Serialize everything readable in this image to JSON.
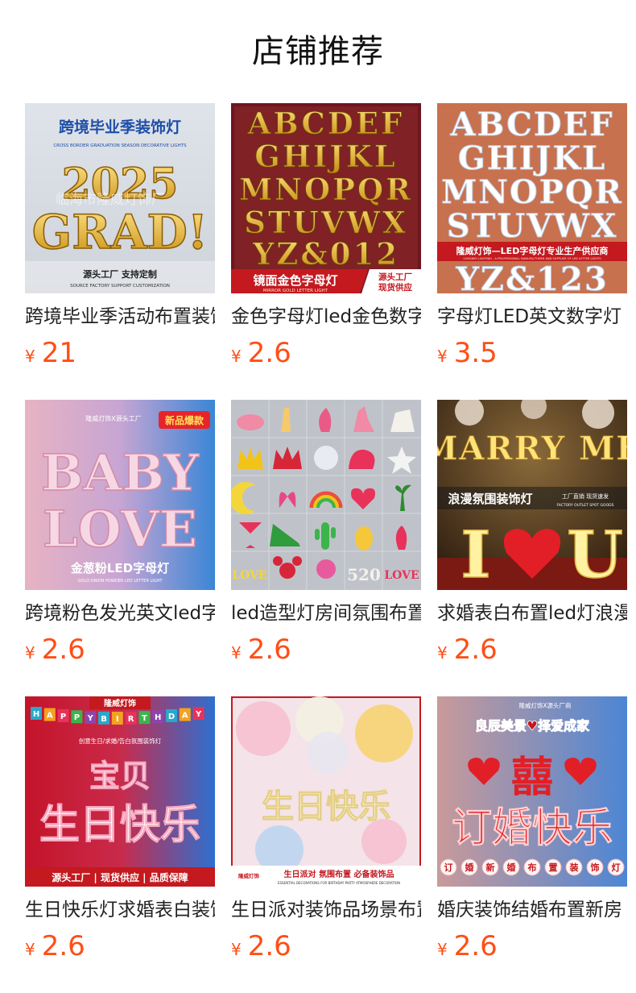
{
  "header": {
    "title": "店铺推荐"
  },
  "products": [
    {
      "title": "跨境毕业季活动布置装饰灯",
      "currency": "¥",
      "price": "21",
      "image": {
        "headline": "跨境毕业季装饰灯",
        "subline": "CROSS BORDER GRADUATION SEASON DECORATIVE LIGHTS",
        "big_top": "2025",
        "big_bottom": "GRAD!",
        "watermark": "临海市隆威灯饰厂",
        "footer": "源头工厂  支持定制",
        "footer_sub": "SOURCE FACTORY   SUPPORT CUSTOMIZATION"
      }
    },
    {
      "title": "金色字母灯led金色数字灯",
      "currency": "¥",
      "price": "2.6",
      "image": {
        "rows": [
          "ABCDEF",
          "GHIJKL",
          "MNOPQR",
          "STUVWX",
          "YZ&012"
        ],
        "banner": "镜面金色字母灯",
        "banner_sub": "MIRROR GOLD LETTER LIGHT",
        "tag_1": "源头工厂",
        "tag_2": "现货供应"
      }
    },
    {
      "title": "字母灯LED英文数字灯",
      "currency": "¥",
      "price": "3.5",
      "image": {
        "rows": [
          "ABCDEF",
          "GHIJKL",
          "MNOPQR",
          "STUVWX",
          "YZ&123"
        ],
        "banner": "隆威灯饰—LED字母灯专业生产供应商",
        "banner_sub": "LONGWEI LIGHTING - A PROFESSIONAL MANUFACTURER AND SUPPLIER OF LED LETTER LIGHTS"
      }
    },
    {
      "title": "跨境粉色发光英文led字母灯",
      "currency": "¥",
      "price": "2.6",
      "image": {
        "brand": "隆威灯饰X源头工厂",
        "badge": "新品爆款",
        "word_1": "BABY",
        "word_2": "LOVE",
        "footer": "金葱粉LED字母灯",
        "footer_sub": "GOLD ONION POWDER LED LETTER LIGHT"
      }
    },
    {
      "title": "led造型灯房间氛围布置",
      "currency": "¥",
      "price": "2.6",
      "image": {
        "tile_1": "LOVE",
        "tile_2": "520",
        "tile_3": "LOVE"
      }
    },
    {
      "title": "求婚表白布置led灯浪漫",
      "currency": "¥",
      "price": "2.6",
      "image": {
        "word_top": "MARRY ME",
        "banner": "浪漫氛围装饰灯",
        "tag_1": "工厂直销  现货速发",
        "tag_2": "FACTORY OUTLET   SPOT GOODS",
        "letter_1": "I",
        "letter_2": "U"
      }
    },
    {
      "title": "生日快乐灯求婚表白装饰",
      "currency": "¥",
      "price": "2.6",
      "image": {
        "brand": "隆威灯饰",
        "bunting": [
          "H",
          "A",
          "P",
          "P",
          "Y",
          "B",
          "I",
          "R",
          "T",
          "H",
          "D",
          "A",
          "Y"
        ],
        "subline": "创意生日/求婚/告白氛围装饰灯",
        "word_1": "宝贝",
        "word_2": "生日快乐",
        "footer": "源头工厂 | 现货供应 | 品质保障"
      }
    },
    {
      "title": "生日派对装饰品场景布置",
      "currency": "¥",
      "price": "2.6",
      "image": {
        "word": "生日快乐",
        "logo": "隆威灯饰",
        "footer": "生日派对 氛围布置 必备装饰品",
        "footer_sub": "ESSENTIAL DECORATIONS FOR BIRTHDAY PARTY ATMOSPHERE DECORATION"
      }
    },
    {
      "title": "婚庆装饰结婚布置新房",
      "currency": "¥",
      "price": "2.6",
      "image": {
        "brand": "隆威灯饰X源头厂商",
        "banner": "良辰美景♥择爱成家",
        "big_char": "囍",
        "word": "订婚快乐",
        "bottom_chars": [
          "订",
          "婚",
          "新",
          "婚",
          "布",
          "置",
          "装",
          "饰",
          "灯"
        ]
      }
    }
  ]
}
